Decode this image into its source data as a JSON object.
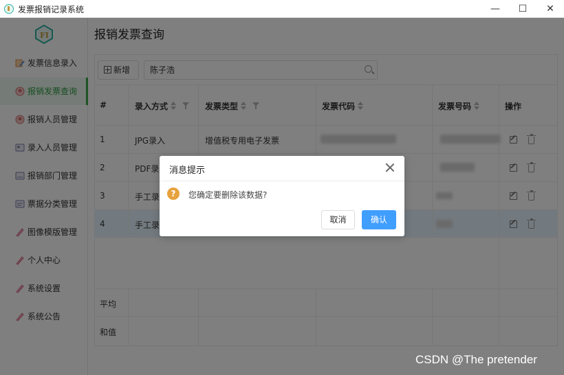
{
  "window": {
    "title": "发票报销记录系统",
    "min_icon": "minimize-icon",
    "max_icon": "maximize-icon",
    "close_icon": "close-icon"
  },
  "sidebar": {
    "items": [
      {
        "label": "发票信息录入",
        "icon": "invoice-entry-icon"
      },
      {
        "label": "报销发票查询",
        "icon": "invoice-query-icon",
        "active": true
      },
      {
        "label": "报销人员管理",
        "icon": "people-icon"
      },
      {
        "label": "录入人员管理",
        "icon": "entry-user-icon"
      },
      {
        "label": "报销部门管理",
        "icon": "department-icon"
      },
      {
        "label": "票据分类管理",
        "icon": "category-icon"
      },
      {
        "label": "图像模版管理",
        "icon": "template-icon"
      },
      {
        "label": "个人中心",
        "icon": "user-icon"
      },
      {
        "label": "系统设置",
        "icon": "settings-icon"
      },
      {
        "label": "系统公告",
        "icon": "notice-icon"
      }
    ]
  },
  "main": {
    "title": "报销发票查询",
    "add_label": "新增",
    "search_value": "陈子浩"
  },
  "table": {
    "headers": [
      "#",
      "录入方式",
      "发票类型",
      "发票代码",
      "发票号码",
      "操作"
    ],
    "rows": [
      {
        "index": "1",
        "method": "JPG录入",
        "type": "增值税专用电子发票"
      },
      {
        "index": "2",
        "method": "PDF录入",
        "type": ""
      },
      {
        "index": "3",
        "method": "手工录入",
        "type": ""
      },
      {
        "index": "4",
        "method": "手工录入",
        "type": ""
      }
    ],
    "footer": [
      "平均",
      "和值"
    ]
  },
  "dialog": {
    "title": "消息提示",
    "message": "您确定要删除该数据?",
    "cancel_label": "取消",
    "confirm_label": "确认",
    "icon_glyph": "?"
  },
  "watermark": "CSDN @The  pretender",
  "colors": {
    "accent": "#409eff",
    "active_nav": "#2f9d45",
    "warning": "#e6a23c"
  }
}
